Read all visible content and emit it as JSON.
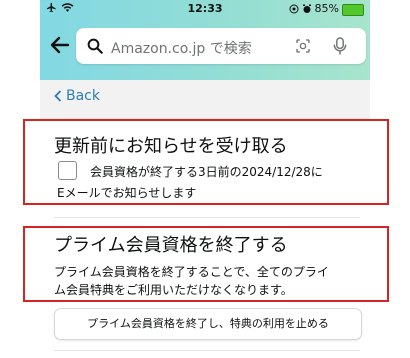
{
  "status_bar": {
    "time": "12:33",
    "battery_text": "85%",
    "icons": [
      "airplane-icon",
      "wifi-icon",
      "location-icon",
      "alarm-icon",
      "battery-icon"
    ]
  },
  "search": {
    "placeholder": "Amazon.co.jp で検索"
  },
  "nav": {
    "back_label": "Back"
  },
  "notify_section": {
    "title": "更新前にお知らせを受け取る",
    "checkbox_checked": false,
    "text_line1": "会員資格が終了する3日前の2024/12/28に",
    "text_line2": "Eメールでお知らせします"
  },
  "end_section": {
    "title": "プライム会員資格を終了する",
    "desc_line1": "プライム会員資格を終了することで、全てのプライ",
    "desc_line2": "ム会員特典をご利用いただけなくなります。",
    "button_label": "プライム会員資格を終了し、特典の利用を止める"
  },
  "colors": {
    "header_gradient_start": "#82d8e3",
    "header_gradient_end": "#a7e5cc",
    "link": "#2d7db7",
    "highlight_border": "#d42424",
    "battery_fill": "#52c72e"
  }
}
